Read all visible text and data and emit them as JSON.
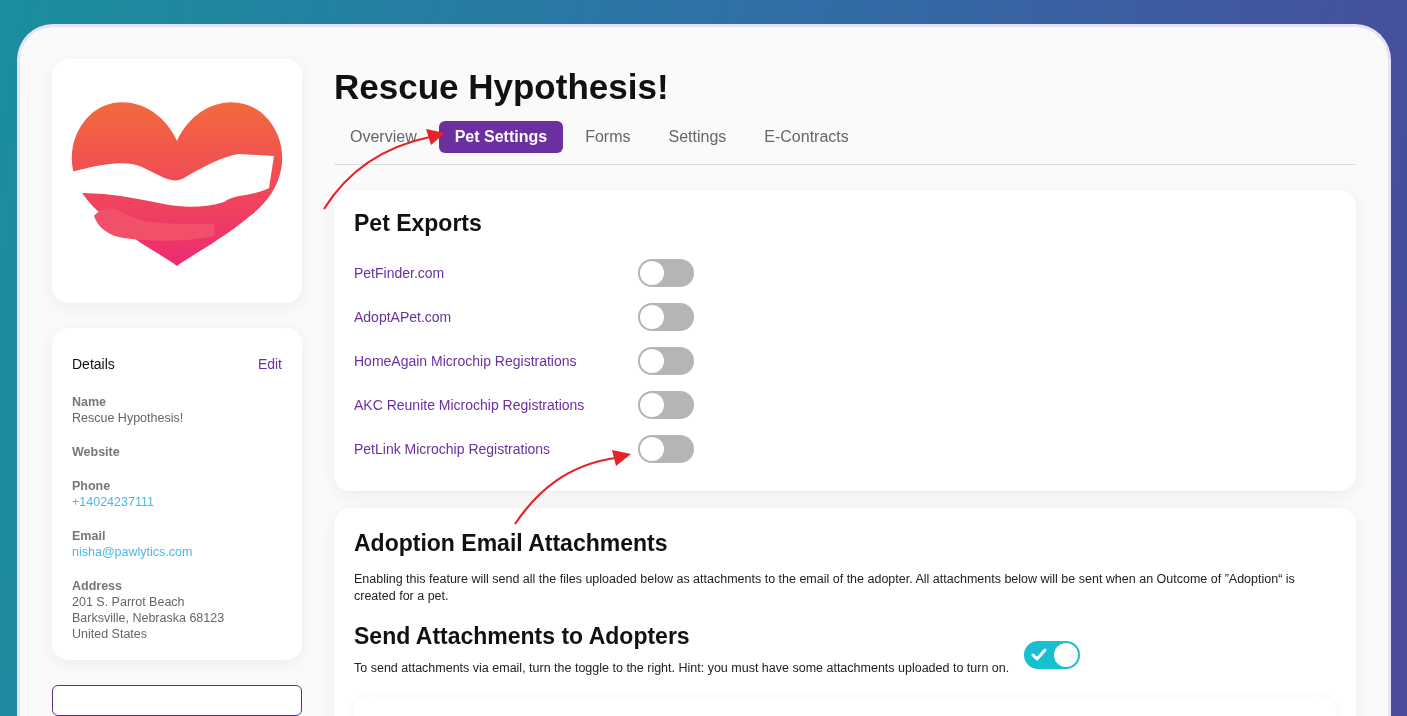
{
  "sidebar": {
    "details": {
      "title": "Details",
      "edit": "Edit",
      "fields": [
        {
          "label": "Name",
          "kind": "text",
          "lines": [
            "Rescue Hypothesis!"
          ]
        },
        {
          "label": "Website"
        },
        {
          "label": "Phone",
          "kind": "link",
          "lines": [
            "+14024237111"
          ]
        },
        {
          "label": "Email",
          "kind": "link",
          "lines": [
            "nisha@pawlytics.com"
          ]
        },
        {
          "label": "Address",
          "kind": "text",
          "lines": [
            "201 S. Parrot Beach",
            "Barksville, Nebraska 68123",
            "United States"
          ]
        }
      ]
    }
  },
  "header": {
    "title": "Rescue Hypothesis!"
  },
  "tabs": [
    {
      "label": "Overview",
      "selected": false
    },
    {
      "label": "Pet Settings",
      "selected": true
    },
    {
      "label": "Forms",
      "selected": false
    },
    {
      "label": "Settings",
      "selected": false
    },
    {
      "label": "E-Contracts",
      "selected": false
    }
  ],
  "pet_exports": {
    "title": "Pet Exports",
    "items": [
      {
        "label": "PetFinder.com",
        "on": false
      },
      {
        "label": "AdoptAPet.com",
        "on": false
      },
      {
        "label": "HomeAgain Microchip Registrations",
        "on": false
      },
      {
        "label": "AKC Reunite Microchip Registrations",
        "on": false
      },
      {
        "label": "PetLink Microchip Registrations",
        "on": false
      }
    ]
  },
  "adoption_attachments": {
    "title": "Adoption Email Attachments",
    "description": "Enabling this feature will send all the files uploaded below as attachments to the email of the adopter. All attachments below will be sent when an Outcome of ”Adoption“ is created for a pet."
  },
  "send_attachments": {
    "title": "Send Attachments to Adopters",
    "description": "To send attachments via email, turn the toggle to the right. Hint: you must have some attachments uploaded to turn on.",
    "on": true
  }
}
